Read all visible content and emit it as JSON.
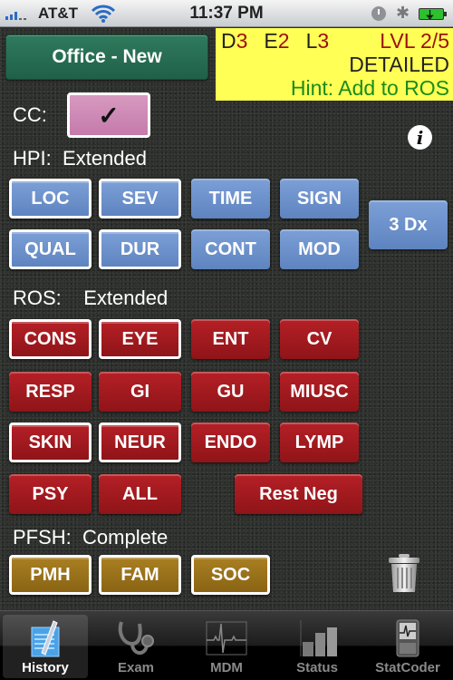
{
  "status_bar": {
    "carrier": "AT&T",
    "time": "11:37 PM",
    "icons": [
      "signal-icon",
      "wifi-icon",
      "alarm-icon",
      "bluetooth-icon",
      "battery-charging-icon"
    ]
  },
  "header": {
    "visit_type_label": "Office - New",
    "level_panel": {
      "d_label": "D",
      "d_value": "3",
      "e_label": "E",
      "e_value": "2",
      "l_label": "L",
      "l_value": "3",
      "lvl": "LVL 2/5",
      "level_name": "DETAILED",
      "hint": "Hint: Add to ROS"
    }
  },
  "cc": {
    "label": "CC:",
    "check": "✓",
    "selected": true
  },
  "hpi": {
    "label": "HPI:",
    "value": "Extended",
    "buttons": [
      {
        "label": "LOC",
        "selected": true
      },
      {
        "label": "SEV",
        "selected": true
      },
      {
        "label": "TIME",
        "selected": false
      },
      {
        "label": "SIGN",
        "selected": false
      },
      {
        "label": "QUAL",
        "selected": true
      },
      {
        "label": "DUR",
        "selected": true
      },
      {
        "label": "CONT",
        "selected": false
      },
      {
        "label": "MOD",
        "selected": false
      }
    ],
    "dx_button": "3 Dx"
  },
  "ros": {
    "label": "ROS:",
    "value": "Extended",
    "buttons": [
      {
        "label": "CONS",
        "selected": true
      },
      {
        "label": "EYE",
        "selected": true
      },
      {
        "label": "ENT",
        "selected": false
      },
      {
        "label": "CV",
        "selected": false
      },
      {
        "label": "RESP",
        "selected": false
      },
      {
        "label": "GI",
        "selected": false
      },
      {
        "label": "GU",
        "selected": false
      },
      {
        "label": "MIUSC",
        "selected": false
      },
      {
        "label": "SKIN",
        "selected": true
      },
      {
        "label": "NEUR",
        "selected": true
      },
      {
        "label": "ENDO",
        "selected": false
      },
      {
        "label": "LYMP",
        "selected": false
      },
      {
        "label": "PSY",
        "selected": false
      },
      {
        "label": "ALL",
        "selected": false
      }
    ],
    "rest_neg": "Rest Neg"
  },
  "pfsh": {
    "label": "PFSH:",
    "value": "Complete",
    "buttons": [
      {
        "label": "PMH",
        "selected": true
      },
      {
        "label": "FAM",
        "selected": true
      },
      {
        "label": "SOC",
        "selected": true
      }
    ]
  },
  "colors": {
    "hpi_blue": "#6a8fcb",
    "ros_red": "#a11a1f",
    "pfsh_gold": "#9a7019",
    "visit_green": "#277055",
    "cc_pink": "#cd86b5",
    "panel_yellow": "#ffff55"
  },
  "tabs": [
    {
      "label": "History",
      "icon": "history-notepad-icon",
      "active": true
    },
    {
      "label": "Exam",
      "icon": "stethoscope-icon",
      "active": false
    },
    {
      "label": "MDM",
      "icon": "ekg-icon",
      "active": false
    },
    {
      "label": "Status",
      "icon": "bar-chart-icon",
      "active": false
    },
    {
      "label": "StatCoder",
      "icon": "device-icon",
      "active": false
    }
  ]
}
